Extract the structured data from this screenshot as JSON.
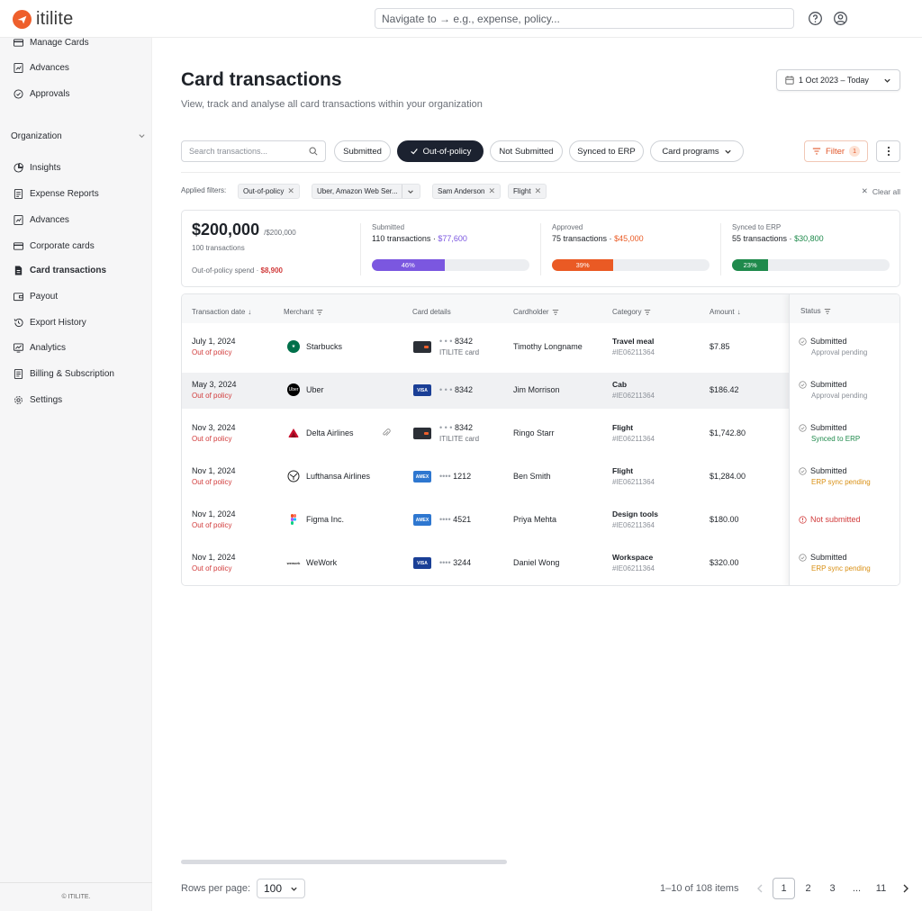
{
  "app": {
    "logo_text": "itilite",
    "nav_placeholder": "Navigate to → e.g., expense, policy..."
  },
  "sidebar": {
    "top_items": [
      {
        "label": "Manage Cards",
        "icon": "card-icon"
      },
      {
        "label": "Advances",
        "icon": "advance-icon"
      },
      {
        "label": "Approvals",
        "icon": "check-circle-icon"
      }
    ],
    "section_label": "Organization",
    "org_items": [
      {
        "label": "Insights",
        "icon": "pie-icon"
      },
      {
        "label": "Expense Reports",
        "icon": "report-icon"
      },
      {
        "label": "Advances",
        "icon": "advance-icon"
      },
      {
        "label": "Corporate cards",
        "icon": "card-icon"
      },
      {
        "label": "Card transactions",
        "icon": "document-icon",
        "active": true
      },
      {
        "label": "Payout",
        "icon": "wallet-icon"
      },
      {
        "label": "Export History",
        "icon": "history-icon"
      },
      {
        "label": "Analytics",
        "icon": "analytics-icon"
      },
      {
        "label": "Billing & Subscription",
        "icon": "billing-icon"
      },
      {
        "label": "Settings",
        "icon": "gear-icon"
      }
    ],
    "footer": "© ITILITE."
  },
  "header": {
    "title": "Card transactions",
    "subtitle": "View, track and analyse all card transactions within your organization",
    "date_range": "1 Oct 2023 – Today"
  },
  "toolbar": {
    "search_placeholder": "Search transactions...",
    "pills": [
      "Submitted",
      "Out-of-policy",
      "Not Submitted",
      "Synced to ERP",
      "Card programs"
    ],
    "selected_pill": "Out-of-policy",
    "filter_label": "Filter",
    "filter_count": "1"
  },
  "applied": {
    "label": "Applied filters:",
    "chips": [
      "Out-of-policy",
      "Uber, Amazon Web Ser...",
      "Sam Anderson",
      "Flight"
    ],
    "clear_label": "Clear all"
  },
  "summary": {
    "total": "$200,000",
    "total_of": "/$200,000",
    "count": "100 transactions",
    "oop_label": "Out-of-policy spend ·",
    "oop_value": "$8,900",
    "stats": [
      {
        "label": "Submitted",
        "value": "110 transactions ·",
        "amount": "$77,600",
        "percent": "46%",
        "fraction": 0.46,
        "color": "#7b57e0"
      },
      {
        "label": "Approved",
        "value": "75 transactions ·",
        "amount": "$45,000",
        "percent": "39%",
        "fraction": 0.39,
        "color": "#ea5a24"
      },
      {
        "label": "Synced to ERP",
        "value": "55 transactions ·",
        "amount": "$30,800",
        "percent": "23%",
        "fraction": 0.23,
        "color": "#1f8a4c"
      }
    ]
  },
  "table": {
    "columns": [
      "Transaction date",
      "Merchant",
      "Card details",
      "Cardholder",
      "Category",
      "Amount",
      "Status"
    ],
    "rows": [
      {
        "date": "July 1, 2024",
        "flag": "Out of policy",
        "merchant": "Starbucks",
        "merchant_logo": "starbucks-logo",
        "card_type": "ITILITE",
        "card_mask": "• • •",
        "card_last4": "8342",
        "card_sub": "ITILITE card",
        "holder": "Timothy Longname",
        "category": "Travel meal",
        "cat_id": "#IE06211364",
        "amount": "$7.85",
        "status": "Submitted",
        "status_sub": "Approval pending",
        "status_sub_color": "#8b9098"
      },
      {
        "date": "May 3, 2024",
        "flag": "Out of policy",
        "merchant": "Uber",
        "merchant_logo": "uber-logo",
        "card_type": "VISA",
        "card_mask": "• • •",
        "card_last4": "8342",
        "card_sub": "",
        "holder": "Jim Morrison",
        "category": "Cab",
        "cat_id": "#IE06211364",
        "amount": "$186.42",
        "status": "Submitted",
        "status_sub": "Approval pending",
        "status_sub_color": "#8b9098"
      },
      {
        "date": "Nov 3, 2024",
        "flag": "Out of policy",
        "merchant": "Delta Airlines",
        "merchant_logo": "delta-logo",
        "card_type": "ITILITE",
        "card_mask": "• • •",
        "card_last4": "8342",
        "card_sub": "ITILITE card",
        "holder": "Ringo Starr",
        "category": "Flight",
        "cat_id": "#IE06211364",
        "amount": "$1,742.80",
        "status": "Submitted",
        "status_sub": "Synced to ERP",
        "status_sub_color": "#1f8a4c"
      },
      {
        "date": "Nov 1, 2024",
        "flag": "Out of policy",
        "merchant": "Lufthansa Airlines",
        "merchant_logo": "lufthansa-logo",
        "card_type": "AMEX",
        "card_mask": "••••",
        "card_last4": "1212",
        "card_sub": "",
        "holder": "Ben Smith",
        "category": "Flight",
        "cat_id": "#IE06211364",
        "amount": "$1,284.00",
        "status": "Submitted",
        "status_sub": "ERP sync pending",
        "status_sub_color": "#d99015"
      },
      {
        "date": "Nov 1, 2024",
        "flag": "Out of policy",
        "merchant": "Figma Inc.",
        "merchant_logo": "figma-logo",
        "card_type": "AMEX",
        "card_mask": "••••",
        "card_last4": "4521",
        "card_sub": "",
        "holder": "Priya Mehta",
        "category": "Design tools",
        "cat_id": "#IE06211364",
        "amount": "$180.00",
        "status": "Not submitted",
        "status_sub": "",
        "status_sub_color": "#8b9098"
      },
      {
        "date": "Nov 1, 2024",
        "flag": "Out of policy",
        "merchant": "WeWork",
        "merchant_logo": "wework-logo",
        "card_type": "VISA",
        "card_mask": "••••",
        "card_last4": "3244",
        "card_sub": "",
        "holder": "Daniel Wong",
        "category": "Workspace",
        "cat_id": "#IE06211364",
        "amount": "$320.00",
        "status": "Submitted",
        "status_sub": "ERP sync pending",
        "status_sub_color": "#d99015"
      }
    ]
  },
  "footer": {
    "rows_label": "Rows per page:",
    "rows_value": "100",
    "range": "1–10 of 108 items",
    "pages": [
      "1",
      "2",
      "3",
      "...",
      "11"
    ],
    "current_page": "1"
  },
  "colors": {
    "brand": "#ee5f2c",
    "accent_dark": "#1c2230",
    "danger": "#d13b3b",
    "success": "#1f8a4c",
    "warning": "#d99015"
  }
}
